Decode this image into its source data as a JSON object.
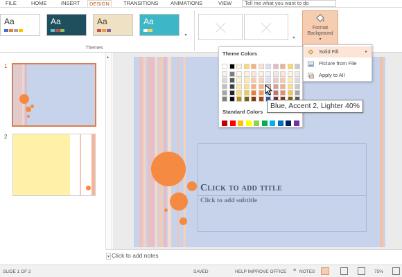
{
  "ribbon_tabs": [
    "FILE",
    "HOME",
    "INSERT",
    "DESIGN",
    "TRANSITIONS",
    "ANIMATIONS",
    "VIEW"
  ],
  "active_tab": "DESIGN",
  "tell_me_placeholder": "Tell me what you want to do",
  "themes": {
    "group_label": "Themes",
    "items": [
      {
        "name": "office-theme",
        "aa": "Aa"
      },
      {
        "name": "dark-teal-theme",
        "aa": "Aa"
      },
      {
        "name": "wood-theme",
        "aa": "Aa"
      },
      {
        "name": "teal-theme",
        "aa": "Aa"
      }
    ]
  },
  "format_background": {
    "label_line1": "Format",
    "label_line2": "Background"
  },
  "color_dropdown": {
    "theme_colors_heading": "Theme Colors",
    "standard_colors_heading": "Standard Colors",
    "theme_columns": [
      [
        "#ffffff",
        "#f2f2f2",
        "#d9d9d9",
        "#bfbfbf",
        "#a6a6a6",
        "#808080"
      ],
      [
        "#000000",
        "#7f7f7f",
        "#595959",
        "#404040",
        "#262626",
        "#0d0d0d"
      ],
      [
        "#fff2cc",
        "#fffae5",
        "#fff4cc",
        "#ffee99",
        "#ffe066",
        "#bf9000"
      ],
      [
        "#ffd966",
        "#fff5d6",
        "#ffecad",
        "#ffe085",
        "#f2c94c",
        "#7f6000"
      ],
      [
        "#f4b183",
        "#fce4d6",
        "#f8cbad",
        "#f4b183",
        "#ed7d31",
        "#843c0c"
      ],
      [
        "#ffe0cc",
        "#fff0e6",
        "#ffd1b3",
        "#ffb380",
        "#ff944d",
        "#b34700"
      ],
      [
        "#d9e1f2",
        "#eef2f9",
        "#d9e1f2",
        "#b4c7e7",
        "#8faadc",
        "#2f5597"
      ],
      [
        "#e2bdbd",
        "#f5e5e5",
        "#ebcaca",
        "#d99e9e",
        "#c77272",
        "#6b2d2d"
      ],
      [
        "#f4b183",
        "#fce4d6",
        "#f8cbad",
        "#f4b183",
        "#e6905a",
        "#843c0c"
      ],
      [
        "#ffd966",
        "#fff5d6",
        "#ffecad",
        "#ffe085",
        "#f2c94c",
        "#7f6000"
      ],
      [
        "#c9c9c9",
        "#ededed",
        "#dbdbdb",
        "#c9c9c9",
        "#a5a5a5",
        "#595959"
      ]
    ],
    "standard_colors": [
      "#c00000",
      "#ff0000",
      "#ffc000",
      "#ffff00",
      "#92d050",
      "#00b050",
      "#00b0f0",
      "#0070c0",
      "#002060",
      "#7030a0"
    ]
  },
  "tooltip": "Blue, Accent 2, Lighter 40%",
  "submenu": {
    "items": [
      {
        "label": "Solid Fill",
        "icon": "paint-bucket-icon"
      },
      {
        "label": "Picture from File",
        "icon": "picture-icon"
      },
      {
        "label": "Apply to All",
        "icon": "apply-all-icon"
      }
    ]
  },
  "slides": [
    {
      "number": "1"
    },
    {
      "number": "2"
    }
  ],
  "slide": {
    "title_placeholder": "Click to add title",
    "subtitle_placeholder": "Click to add subtitle"
  },
  "notes_placeholder": "Click to add notes",
  "status": {
    "slide_counter": "SLIDE 1 OF 2",
    "saved": "SAVED",
    "help": "HELP IMPROVE OFFICE",
    "notes": "NOTES",
    "zoom": "75%"
  },
  "colors": {
    "accent": "#c55a11",
    "slide_bg": "#c7d3ea",
    "circle": "#f58a42",
    "hover": "#fde4d6"
  }
}
